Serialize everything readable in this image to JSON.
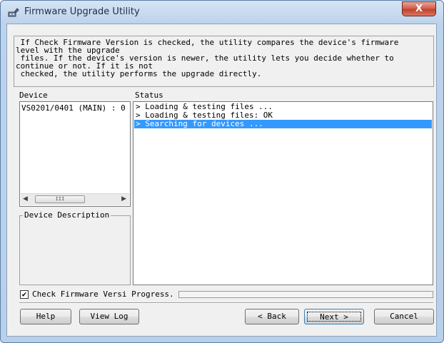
{
  "window": {
    "title": "Firmware Upgrade Utility",
    "close_label": "X"
  },
  "description": {
    "text": " If Check Firmware Version is checked, the utility compares the device's firmware\nlevel with the upgrade\n files. If the device's version is newer, the utility lets you decide whether to\ncontinue or not. If it is not\n checked, the utility performs the upgrade directly."
  },
  "device_panel": {
    "label": "Device",
    "items": [
      "VS0201/0401 (MAIN) : 0"
    ],
    "scroll_left": "◀",
    "scroll_thumb": "III",
    "scroll_right": "▶",
    "description_label": "Device Description"
  },
  "status_panel": {
    "label": "Status",
    "rows": [
      "> Loading & testing files ...",
      "> Loading & testing files: OK",
      "> Searching for devices ..."
    ],
    "selected_index": 2
  },
  "options": {
    "check_firmware_label": "Check Firmware Versi",
    "check_firmware_checked": true,
    "check_mark": "✔",
    "progress_label": "Progress.",
    "progress_value": 0
  },
  "buttons": {
    "help": "Help",
    "view_log": "View Log",
    "back": "< Back",
    "next": "Next >",
    "cancel": "Cancel"
  },
  "colors": {
    "selection": "#3399ff",
    "titlebar": "#bcd3ec",
    "close": "#c2412c"
  },
  "icons": {
    "app": "firmware-plug-icon",
    "close": "close-icon"
  }
}
